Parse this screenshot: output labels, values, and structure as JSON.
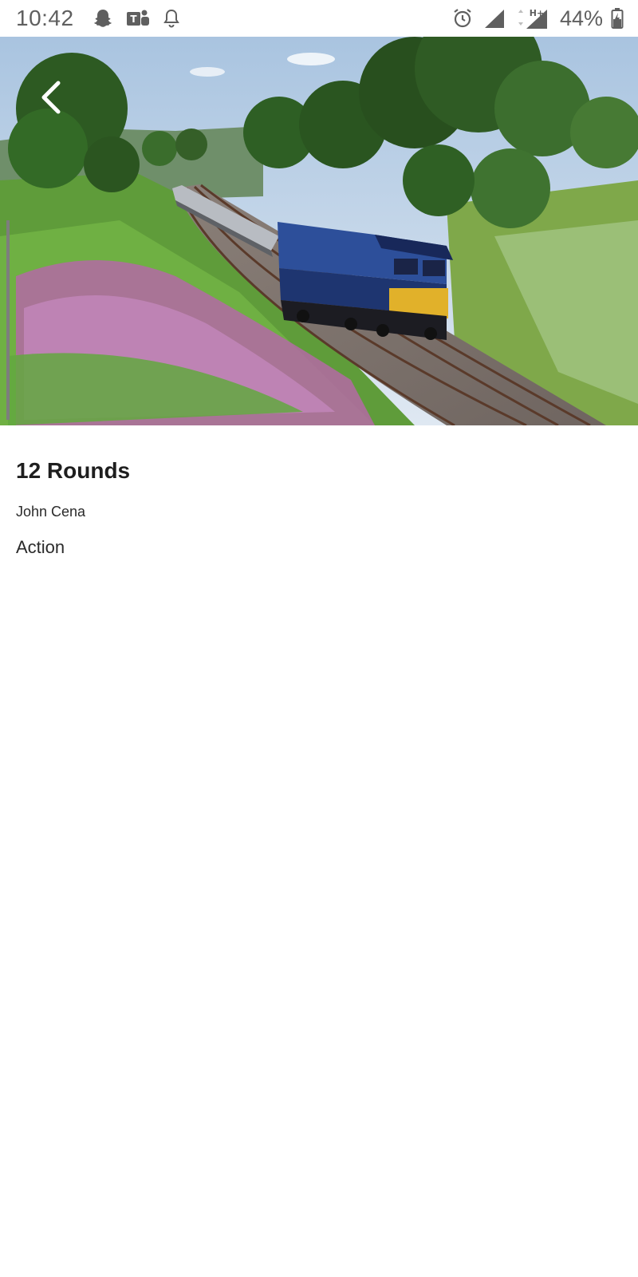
{
  "status_bar": {
    "time": "10:42",
    "notification_icons": [
      "snapchat-icon",
      "teams-icon",
      "bell-icon"
    ],
    "system_icons": [
      "alarm-icon",
      "signal-icon",
      "mobile-data-icon"
    ],
    "network_type": "H+",
    "battery_percent": "44%"
  },
  "hero": {
    "image_subject": "blue diesel freight train on curved track with trees and pink wildflowers"
  },
  "movie": {
    "title": "12 Rounds",
    "author": "John Cena",
    "genre": "Action"
  },
  "colors": {
    "background": "#ffffff",
    "text_primary": "#1e1e1e",
    "status_text": "#5f5f5f"
  }
}
